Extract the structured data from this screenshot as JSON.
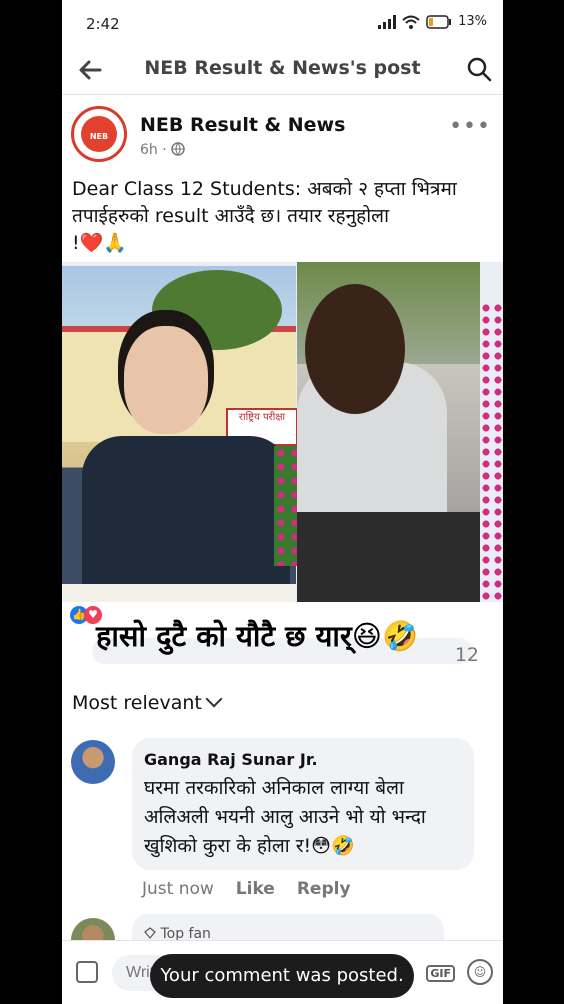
{
  "status_bar": {
    "time": "2:42",
    "battery": "13"
  },
  "app_bar": {
    "title": "NEB Result & News's post"
  },
  "post": {
    "page_name": "NEB Result & News",
    "time": "6h",
    "logo_text": "NEB",
    "caption_line1": "Dear Class 12 Students: अबको २ हप्ता भित्रमा",
    "caption_line2": "तपाईहरुको result आउँदै छ। तयार रहनुहोला",
    "caption_line3": "!❤️🙏",
    "photo_sign": "राष्ट्रिय परीक्षा"
  },
  "reactions": {
    "overlay_text": "हासो दुटै को यौटै छ यार्😆🤣",
    "count": "12"
  },
  "sort": {
    "label": "Most relevant"
  },
  "comment": {
    "author": "Ganga Raj Sunar Jr.",
    "text": "घरमा तरकारिको अनिकाल लाग्या बेला अलिअली भयनी आलु आउने भो यो भन्दा खुशिको कुरा के होला र!😳🤣",
    "time": "Just now",
    "like_label": "Like",
    "reply_label": "Reply"
  },
  "next_comment": {
    "badge": "Top fan"
  },
  "composer": {
    "placeholder": "Write a comment...",
    "gif_label": "GIF"
  },
  "toast": {
    "message": "Your comment was posted."
  },
  "colors": {
    "accent": "#1877f2",
    "logo_red": "#e2412d"
  }
}
